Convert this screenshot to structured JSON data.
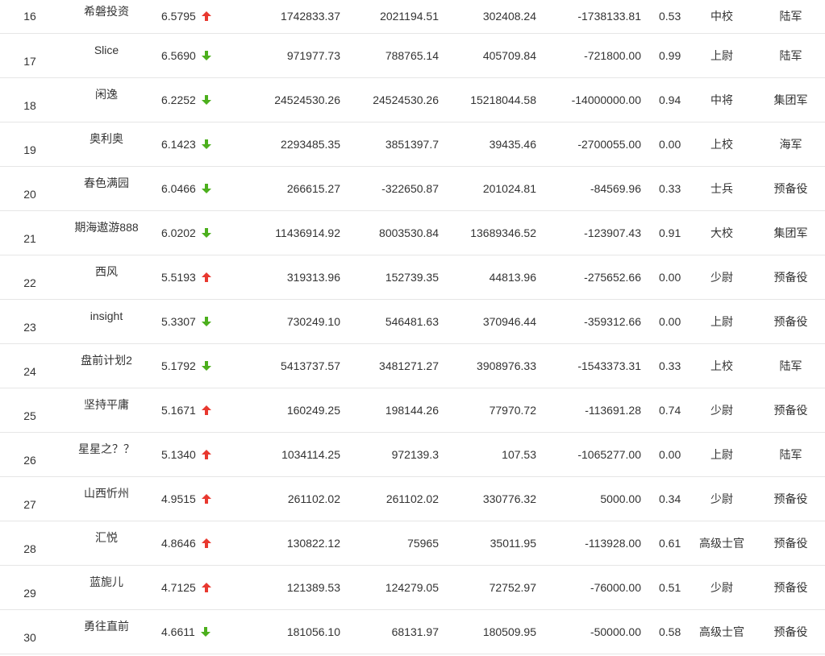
{
  "colors": {
    "up": "#e8382f",
    "down": "#4caf1d"
  },
  "rows": [
    {
      "rank": "16",
      "name": "希磐投资",
      "score": "6.5795",
      "trend": "up",
      "v1": "1742833.37",
      "v2": "2021194.51",
      "v3": "302408.24",
      "v4": "-1738133.81",
      "ratio": "0.53",
      "rankTitle": "中校",
      "branch": "陆军"
    },
    {
      "rank": "17",
      "name": "Slice",
      "score": "6.5690",
      "trend": "down",
      "v1": "971977.73",
      "v2": "788765.14",
      "v3": "405709.84",
      "v4": "-721800.00",
      "ratio": "0.99",
      "rankTitle": "上尉",
      "branch": "陆军"
    },
    {
      "rank": "18",
      "name": "闲逸",
      "score": "6.2252",
      "trend": "down",
      "v1": "24524530.26",
      "v2": "24524530.26",
      "v3": "15218044.58",
      "v4": "-14000000.00",
      "ratio": "0.94",
      "rankTitle": "中将",
      "branch": "集团军"
    },
    {
      "rank": "19",
      "name": "奥利奥",
      "score": "6.1423",
      "trend": "down",
      "v1": "2293485.35",
      "v2": "3851397.7",
      "v3": "39435.46",
      "v4": "-2700055.00",
      "ratio": "0.00",
      "rankTitle": "上校",
      "branch": "海军"
    },
    {
      "rank": "20",
      "name": "春色满园",
      "score": "6.0466",
      "trend": "down",
      "v1": "266615.27",
      "v2": "-322650.87",
      "v3": "201024.81",
      "v4": "-84569.96",
      "ratio": "0.33",
      "rankTitle": "士兵",
      "branch": "预备役"
    },
    {
      "rank": "21",
      "name": "期海遨游888",
      "score": "6.0202",
      "trend": "down",
      "v1": "11436914.92",
      "v2": "8003530.84",
      "v3": "13689346.52",
      "v4": "-123907.43",
      "ratio": "0.91",
      "rankTitle": "大校",
      "branch": "集团军"
    },
    {
      "rank": "22",
      "name": "西风",
      "score": "5.5193",
      "trend": "up",
      "v1": "319313.96",
      "v2": "152739.35",
      "v3": "44813.96",
      "v4": "-275652.66",
      "ratio": "0.00",
      "rankTitle": "少尉",
      "branch": "预备役"
    },
    {
      "rank": "23",
      "name": "insight",
      "score": "5.3307",
      "trend": "down",
      "v1": "730249.10",
      "v2": "546481.63",
      "v3": "370946.44",
      "v4": "-359312.66",
      "ratio": "0.00",
      "rankTitle": "上尉",
      "branch": "预备役"
    },
    {
      "rank": "24",
      "name": "盘前计划2",
      "score": "5.1792",
      "trend": "down",
      "v1": "5413737.57",
      "v2": "3481271.27",
      "v3": "3908976.33",
      "v4": "-1543373.31",
      "ratio": "0.33",
      "rankTitle": "上校",
      "branch": "陆军"
    },
    {
      "rank": "25",
      "name": "坚持平庸",
      "score": "5.1671",
      "trend": "up",
      "v1": "160249.25",
      "v2": "198144.26",
      "v3": "77970.72",
      "v4": "-113691.28",
      "ratio": "0.74",
      "rankTitle": "少尉",
      "branch": "预备役"
    },
    {
      "rank": "26",
      "name": "星星之？？",
      "score": "5.1340",
      "trend": "up",
      "v1": "1034114.25",
      "v2": "972139.3",
      "v3": "107.53",
      "v4": "-1065277.00",
      "ratio": "0.00",
      "rankTitle": "上尉",
      "branch": "陆军"
    },
    {
      "rank": "27",
      "name": "山西忻州",
      "score": "4.9515",
      "trend": "up",
      "v1": "261102.02",
      "v2": "261102.02",
      "v3": "330776.32",
      "v4": "5000.00",
      "ratio": "0.34",
      "rankTitle": "少尉",
      "branch": "预备役"
    },
    {
      "rank": "28",
      "name": "汇悦",
      "score": "4.8646",
      "trend": "up",
      "v1": "130822.12",
      "v2": "75965",
      "v3": "35011.95",
      "v4": "-113928.00",
      "ratio": "0.61",
      "rankTitle": "高级士官",
      "branch": "预备役"
    },
    {
      "rank": "29",
      "name": "蓝旎儿",
      "score": "4.7125",
      "trend": "up",
      "v1": "121389.53",
      "v2": "124279.05",
      "v3": "72752.97",
      "v4": "-76000.00",
      "ratio": "0.51",
      "rankTitle": "少尉",
      "branch": "预备役"
    },
    {
      "rank": "30",
      "name": "勇往直前",
      "score": "4.6611",
      "trend": "down",
      "v1": "181056.10",
      "v2": "68131.97",
      "v3": "180509.95",
      "v4": "-50000.00",
      "ratio": "0.58",
      "rankTitle": "高级士官",
      "branch": "预备役"
    }
  ]
}
